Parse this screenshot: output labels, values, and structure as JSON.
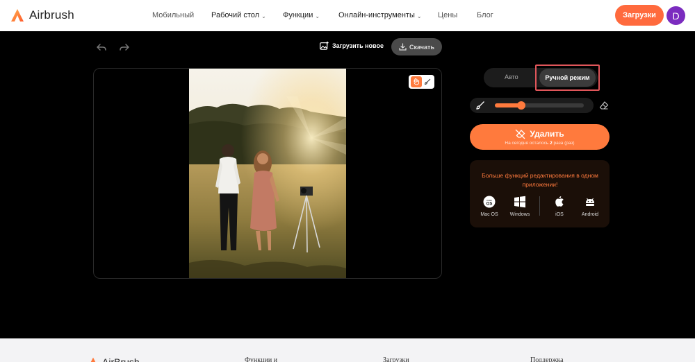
{
  "header": {
    "logo_text": "Airbrush",
    "nav": [
      {
        "label": "Мобильный",
        "chevron": false
      },
      {
        "label": "Рабочий стол",
        "chevron": true
      },
      {
        "label": "Функции",
        "chevron": true
      },
      {
        "label": "Онлайн-инструменты",
        "chevron": true
      },
      {
        "label": "Цены",
        "chevron": false
      },
      {
        "label": "Блог",
        "chevron": false
      }
    ],
    "download_label": "Загрузки",
    "avatar_letter": "D"
  },
  "toolbar": {
    "upload_new_label": "Загрузить новое",
    "save_label": "Скачать"
  },
  "right_panel": {
    "mode_auto": "Авто",
    "mode_manual": "Ручной режим",
    "brush_size_percent": 30,
    "remove_label": "Удалить",
    "remove_sub_prefix": "На сегодня осталось",
    "remove_sub_count": "2",
    "remove_sub_suffix": "раза (раз)",
    "promo_text": "Больше функций редактирования в одном приложении!",
    "platforms": [
      {
        "label": "Mac OS",
        "icon": "macos-icon"
      },
      {
        "label": "Windows",
        "icon": "windows-icon"
      },
      {
        "label": "iOS",
        "icon": "apple-icon"
      },
      {
        "label": "Android",
        "icon": "android-icon"
      }
    ]
  },
  "footer": {
    "logo_text": "AirBrush",
    "columns": [
      "Функции и",
      "Загрузки",
      "Поддержка"
    ]
  },
  "colors": {
    "accent": "#ff7a3d",
    "avatar": "#7b2cbf",
    "highlight": "#e0565a"
  }
}
